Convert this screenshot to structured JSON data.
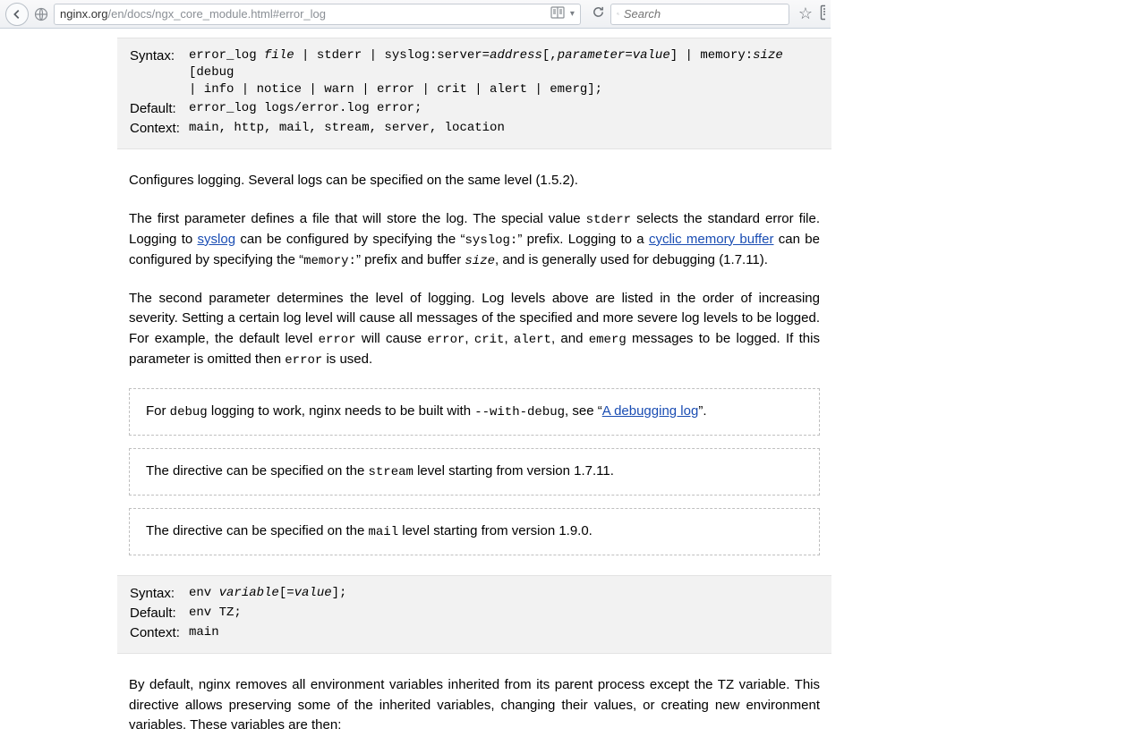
{
  "browser": {
    "url_domain": "nginx.org",
    "url_path": "/en/docs/ngx_core_module.html#error_log",
    "search_placeholder": "Search"
  },
  "directive1": {
    "syntax_label": "Syntax:",
    "default_label": "Default:",
    "context_label": "Context:",
    "syntax_line1_a": "error_log ",
    "syntax_line1_b": "file",
    "syntax_line1_c": " | stderr | syslog:server=",
    "syntax_line1_d": "address",
    "syntax_line1_e": "[,",
    "syntax_line1_f": "parameter",
    "syntax_line1_g": "=",
    "syntax_line1_h": "value",
    "syntax_line1_i": "] | memory:",
    "syntax_line1_j": "size",
    "syntax_line1_k": " [debug",
    "syntax_line2": "| info | notice | warn | error | crit | alert | emerg];",
    "default_value": "error_log logs/error.log error;",
    "context_value": "main, http, mail, stream, server, location"
  },
  "para1": "Configures logging. Several logs can be specified on the same level (1.5.2).",
  "para2": {
    "t1": "The first parameter defines a file that will store the log. The special value ",
    "c1": "stderr",
    "t2": " selects the standard error file. Logging to ",
    "l1": "syslog",
    "t3": " can be configured by specifying the “",
    "c2": "syslog:",
    "t4": "” prefix. Logging to a ",
    "l2": "cyclic memory buffer",
    "t5": " can be configured by specifying the “",
    "c3": "memory:",
    "t6": "” prefix and buffer ",
    "c4": "size",
    "t7": ", and is generally used for debugging (1.7.11)."
  },
  "para3": {
    "t1": "The second parameter determines the level of logging. Log levels above are listed in the order of increasing severity. Setting a certain log level will cause all messages of the specified and more severe log levels to be logged. For example, the default level ",
    "c1": "error",
    "t2": " will cause ",
    "c2": "error",
    "c3": "crit",
    "c4": "alert",
    "t3": ", and ",
    "c5": "emerg",
    "t4": " messages to be logged. If this parameter is omitted then ",
    "c6": "error",
    "t5": " is used."
  },
  "note1": {
    "t1": "For ",
    "c1": "debug",
    "t2": " logging to work, nginx needs to be built with ",
    "c2": "--with-debug",
    "t3": ", see “",
    "l1": "A debugging log",
    "t4": "”."
  },
  "note2": {
    "t1": "The directive can be specified on the ",
    "c1": "stream",
    "t2": " level starting from version 1.7.11."
  },
  "note3": {
    "t1": "The directive can be specified on the ",
    "c1": "mail",
    "t2": " level starting from version 1.9.0."
  },
  "directive2": {
    "syntax_label": "Syntax:",
    "default_label": "Default:",
    "context_label": "Context:",
    "syntax_a": "env ",
    "syntax_b": "variable",
    "syntax_c": "[=",
    "syntax_d": "value",
    "syntax_e": "];",
    "default_value": "env TZ;",
    "context_value": "main"
  },
  "para4": "By default, nginx removes all environment variables inherited from its parent process except the TZ variable. This directive allows preserving some of the inherited variables, changing their values, or creating new environment variables. These variables are then:"
}
